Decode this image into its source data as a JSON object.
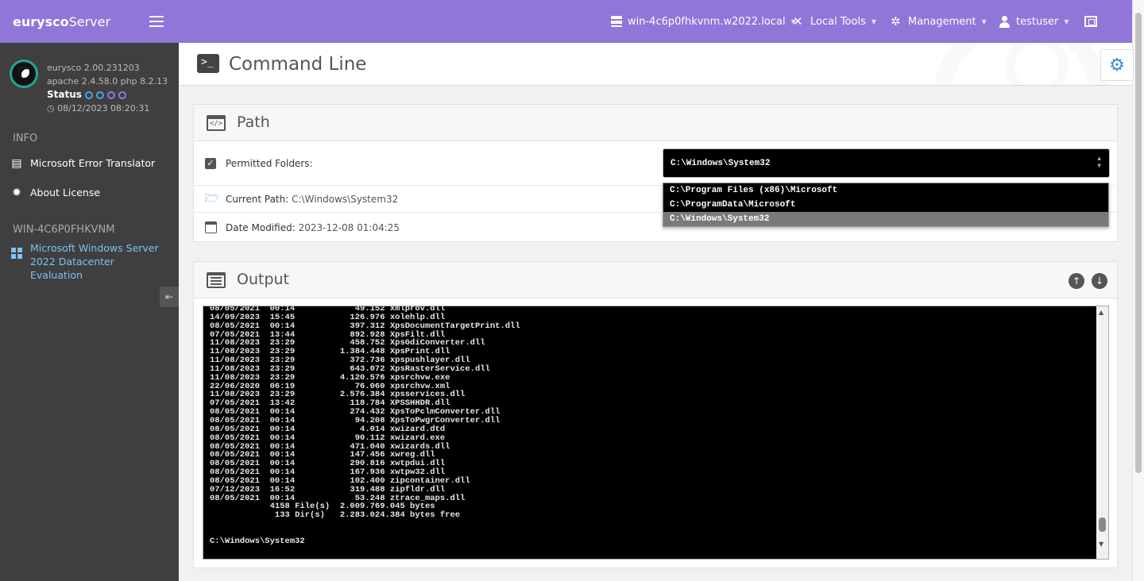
{
  "brand": {
    "bold": "eurysco",
    "rest": "Server"
  },
  "profile": {
    "version": "eurysco 2.00.231203",
    "stack": "apache 2.4.58.0  php 8.2.13",
    "status_label": "Status",
    "timestamp": "08/12/2023 08:20:31"
  },
  "sidebar": {
    "info_heading": "INFO",
    "items": [
      {
        "label": "Microsoft Error Translator"
      },
      {
        "label": "About License"
      }
    ],
    "host_heading": "WIN-4C6P0FHKVNM",
    "os_label": "Microsoft  Windows  Server  2022  Datacenter  Evaluation"
  },
  "topbar": {
    "host": "win-4c6p0fhkvnm.w2022.local",
    "local_tools": "Local Tools",
    "management": "Management",
    "user": "testuser"
  },
  "page": {
    "title": "Command Line"
  },
  "path_panel": {
    "title": "Path",
    "permitted_label": "Permitted Folders:",
    "current_path_label": "Current Path:",
    "current_path_value": "C:\\Windows\\System32",
    "modified_label": "Date Modified:",
    "modified_value": "2023-12-08 01:04:25",
    "selected_folder": "C:\\Windows\\System32",
    "folder_options": [
      "C:\\Program Files (x86)\\Microsoft",
      "C:\\ProgramData\\Microsoft",
      "C:\\Windows\\System32"
    ]
  },
  "output_panel": {
    "title": "Output",
    "text": "08/05/2021  00:14            49.152 xmlprov.dll\n14/09/2023  15:45           126.976 xolehlp.dll\n08/05/2021  00:14           397.312 XpsDocumentTargetPrint.dll\n07/05/2021  13:44           892.928 XpsFilt.dll\n11/08/2023  23:29           458.752 XpsGdiConverter.dll\n11/08/2023  23:29         1.384.448 XpsPrint.dll\n11/08/2023  23:29           372.736 xpspushlayer.dll\n11/08/2023  23:29           643.072 XpsRasterService.dll\n11/08/2023  23:29         4.120.576 xpsrchvw.exe\n22/06/2020  06:19            76.060 xpsrchvw.xml\n11/08/2023  23:29         2.576.384 xpsservices.dll\n07/05/2021  13:42           118.784 XPSSHHDR.dll\n08/05/2021  00:14           274.432 XpsToPclmConverter.dll\n08/05/2021  00:14            94.208 XpsToPwgrConverter.dll\n08/05/2021  00:14             4.014 xwizard.dtd\n08/05/2021  00:14            90.112 xwizard.exe\n08/05/2021  00:14           471.040 xwizards.dll\n08/05/2021  00:14           147.456 xwreg.dll\n08/05/2021  00:14           290.816 xwtpdui.dll\n08/05/2021  00:14           167.936 xwtpw32.dll\n08/05/2021  00:14           102.400 zipcontainer.dll\n07/12/2023  16:52           319.488 zipfldr.dll\n08/05/2021  00:14            53.248 ztrace_maps.dll\n            4158 File(s)  2.009.769.045 bytes\n             133 Dir(s)   2.283.024.384 bytes free\n\n\nC:\\Windows\\System32"
  },
  "icons": {
    "menu": "hamburger-icon",
    "tools": "wrench-icon",
    "management": "gears-icon",
    "user": "user-icon",
    "fullscreen": "fullscreen-icon",
    "settings": "gear-icon"
  },
  "colors": {
    "accent": "#8f76d8",
    "sidebar": "#3f3f3f",
    "link": "#7cc3f2",
    "terminal": "#000000"
  }
}
